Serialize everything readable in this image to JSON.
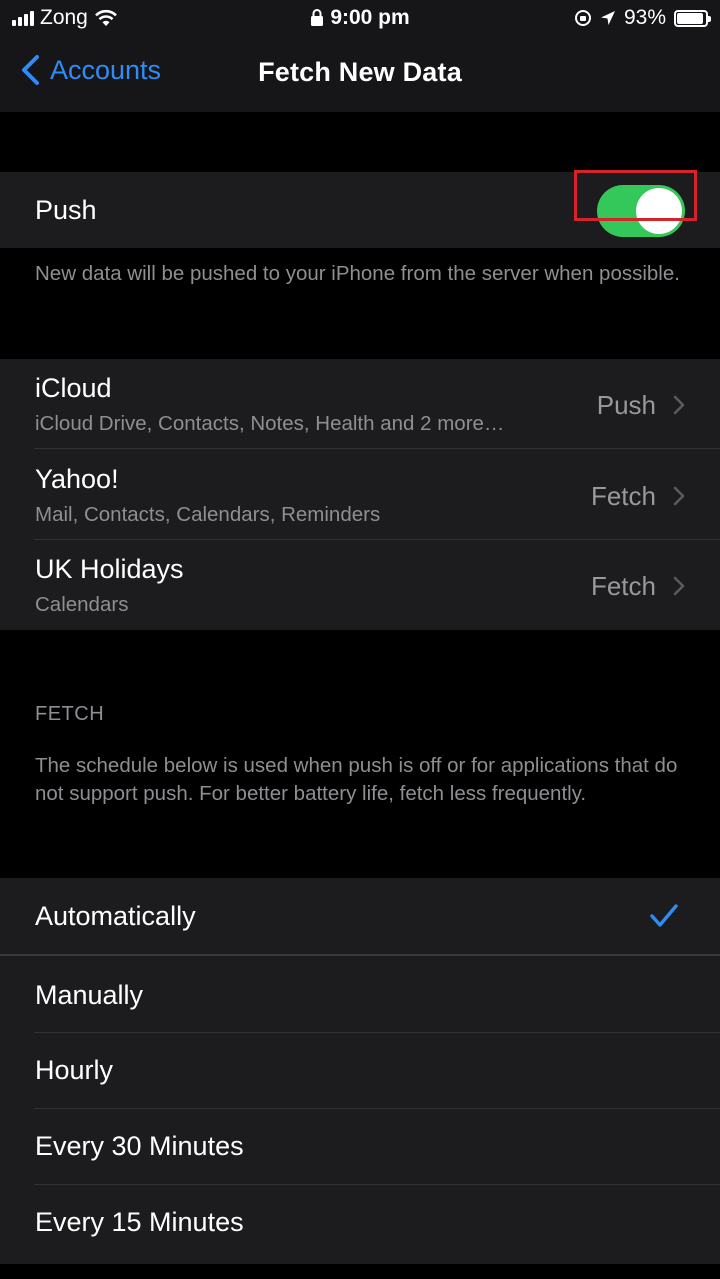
{
  "status_bar": {
    "carrier": "Zong",
    "time": "9:00 pm",
    "battery": "93%",
    "battery_level": 0.93
  },
  "nav": {
    "back_label": "Accounts",
    "title": "Fetch New Data"
  },
  "push": {
    "label": "Push",
    "enabled": true,
    "description": "New data will be pushed to your iPhone from the server when possible."
  },
  "accounts": [
    {
      "name": "iCloud",
      "services": "iCloud Drive, Contacts, Notes, Health and 2 more…",
      "mode": "Push"
    },
    {
      "name": "Yahoo!",
      "services": "Mail, Contacts, Calendars, Reminders",
      "mode": "Fetch"
    },
    {
      "name": "UK Holidays",
      "services": "Calendars",
      "mode": "Fetch"
    }
  ],
  "fetch": {
    "header": "FETCH",
    "description": "The schedule below is used when push is off or for applications that do not support push. For better battery life, fetch less frequently.",
    "options": [
      {
        "label": "Automatically",
        "selected": true
      },
      {
        "label": "Manually",
        "selected": false
      },
      {
        "label": "Hourly",
        "selected": false
      },
      {
        "label": "Every 30 Minutes",
        "selected": false
      },
      {
        "label": "Every 15 Minutes",
        "selected": false
      }
    ]
  },
  "colors": {
    "accent": "#2f8cf7",
    "toggle_on": "#34c759",
    "highlight": "#d4232a"
  }
}
